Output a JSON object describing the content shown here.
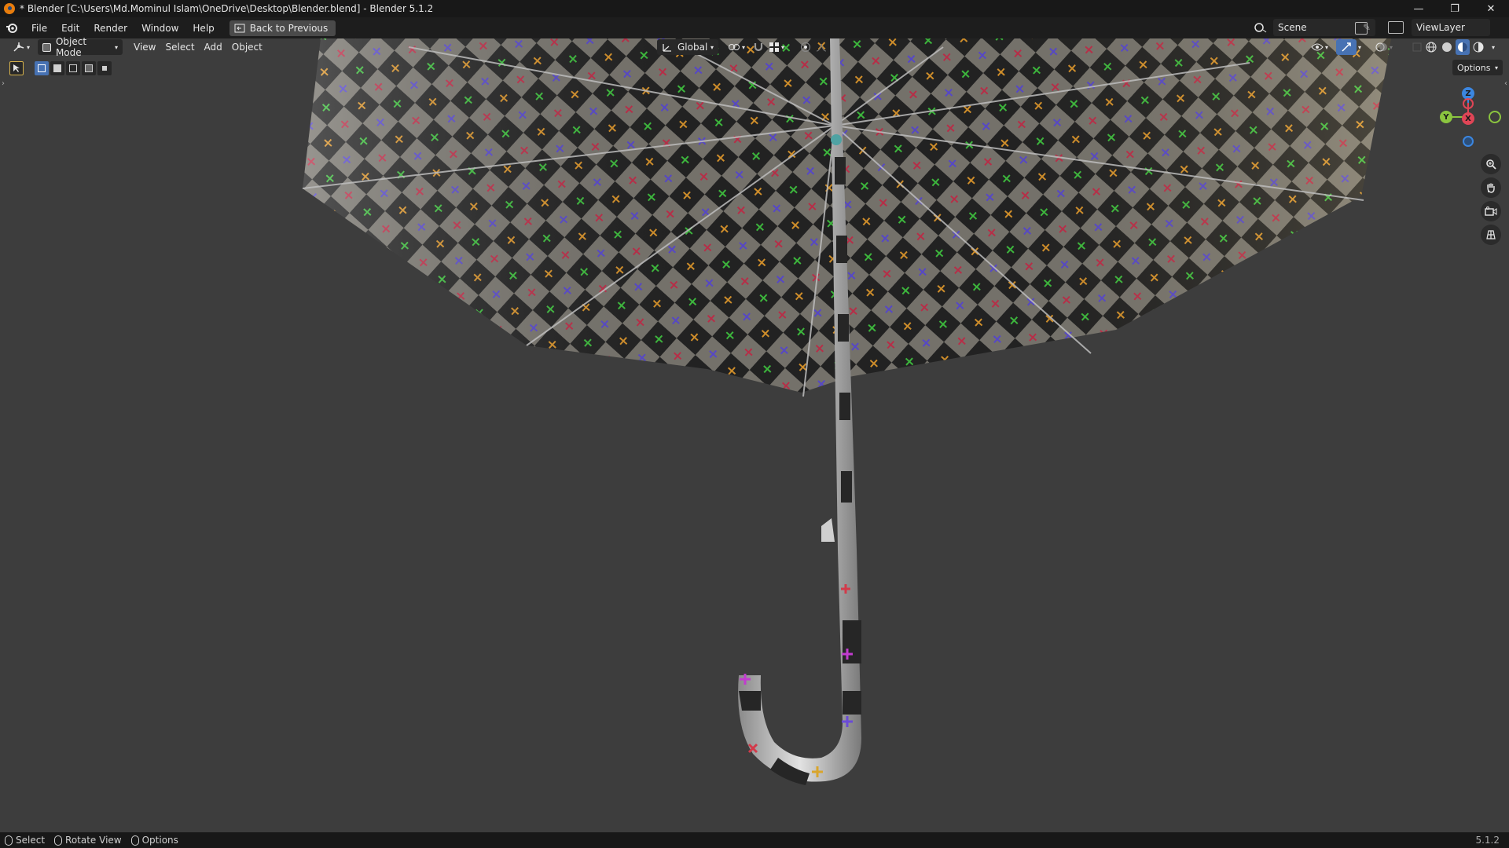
{
  "window": {
    "title": "* Blender [C:\\Users\\Md.Mominul Islam\\OneDrive\\Desktop\\Blender.blend] - Blender 5.1.2",
    "minimize": "—",
    "maximize": "❐",
    "close": "✕"
  },
  "menubar": {
    "items": [
      "File",
      "Edit",
      "Render",
      "Window",
      "Help"
    ],
    "back_button": "Back to Previous",
    "scene_label": "Scene",
    "viewlayer_label": "ViewLayer"
  },
  "viewport_header": {
    "mode": "Object Mode",
    "menus": [
      "View",
      "Select",
      "Add",
      "Object"
    ],
    "transform_orientation": "Global",
    "options_label": "Options"
  },
  "gizmo": {
    "z": "Z",
    "y": "Y",
    "x": "X"
  },
  "statusbar": {
    "select": "Select",
    "rotate": "Rotate View",
    "options": "Options",
    "version": "5.1.2"
  },
  "colors": {
    "accent_blue": "#4772b3",
    "axis_x": "#e04556",
    "axis_y": "#8bc53f",
    "axis_z": "#3b86e0"
  }
}
